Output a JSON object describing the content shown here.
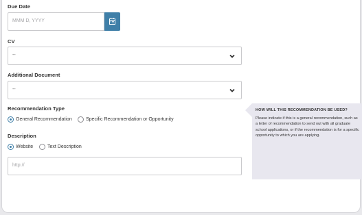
{
  "due_date": {
    "label": "Due Date",
    "placeholder": "MMM D, YYYY",
    "calendar_icon": "calendar-icon"
  },
  "cv": {
    "label": "CV",
    "value": "--",
    "icon": "chevron-down-icon"
  },
  "additional_document": {
    "label": "Additional Document",
    "value": "--",
    "icon": "chevron-down-icon"
  },
  "recommendation_type": {
    "label": "Recommendation Type",
    "options": [
      {
        "label": "General Recommendation",
        "selected": true
      },
      {
        "label": "Specific Recommendation or Opportunity",
        "selected": false
      }
    ]
  },
  "description": {
    "label": "Description",
    "options": [
      {
        "label": "Website",
        "selected": true
      },
      {
        "label": "Text Description",
        "selected": false
      }
    ],
    "url_placeholder": "http://"
  },
  "help": {
    "title": "HOW WILL THIS RECOMMENDATION BE USED?",
    "body": "Please indicate if this is a general recommendation, such as a letter of recommendation to send out with all graduate school applications, or if the recommendation is for a specific opportunity to which you are applying."
  },
  "colors": {
    "accent": "#3f7fa8",
    "help_bg": "#e8e7ef"
  }
}
